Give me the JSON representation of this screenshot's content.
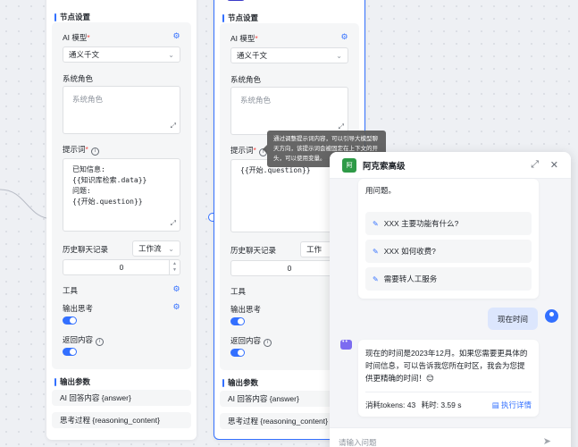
{
  "node1": {
    "section_node_settings": "节点设置",
    "ai_model_label": "AI 模型",
    "required_mark": "*",
    "model_value": "通义千文",
    "system_role_label": "系统角色",
    "system_role_placeholder": "系统角色",
    "prompt_label": "提示词",
    "prompt_value": "已知信息:\n{{知识库检索.data}}\n问题:\n{{开始.question}}",
    "history_label": "历史聊天记录",
    "history_select": "工作流",
    "history_count": "0",
    "tools_label": "工具",
    "output_thinking_label": "输出思考",
    "return_content_label": "返回内容",
    "output_params_label": "输出参数",
    "output_1": "AI 回答内容 {answer}",
    "output_2": "思考过程 {reasoning_content}"
  },
  "node2": {
    "section_node_settings": "节点设置",
    "ai_model_label": "AI 模型",
    "required_mark": "*",
    "model_value": "通义千文",
    "system_role_label": "系统角色",
    "system_role_placeholder": "系统角色",
    "prompt_label": "提示词",
    "prompt_value": "{{开始.question}}",
    "history_label": "历史聊天记录",
    "history_select": "工作",
    "history_count": "0",
    "tools_label": "工具",
    "output_thinking_label": "输出思考",
    "return_content_label": "返回内容",
    "output_params_label": "输出参数",
    "output_1": "AI 回答内容 {answer}",
    "output_2": "思考过程 {reasoning_content}"
  },
  "tooltip": {
    "text": "通过调整提示词内容，可以引导大模型聊天方向，该提示词会被固定在上下文的开头，可以使用变量。"
  },
  "chat": {
    "avatar_text": "阿",
    "title": "阿克索高级",
    "intro_tail": "用问题。",
    "suggestions": [
      "XXX 主要功能有什么?",
      "XXX 如何收费?",
      "需要转人工服务"
    ],
    "user_message": "现在时间",
    "bot_reply": "现在的时间是2023年12月。如果您需要更具体的时间信息，可以告诉我您所在时区，我会为您提供更精确的时间！😊",
    "tokens_label": "消耗tokens: 43",
    "time_label": "耗时: 3.59 s",
    "detail_link": "执行详情",
    "input_placeholder": "请输入问题"
  }
}
